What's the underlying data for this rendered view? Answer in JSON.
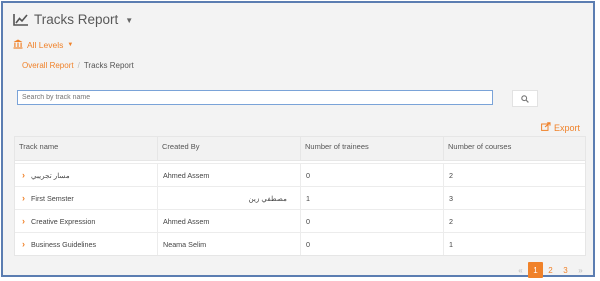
{
  "header": {
    "title": "Tracks Report",
    "levels_label": "All Levels"
  },
  "breadcrumb": {
    "parent": "Overall Report",
    "separator": "/",
    "current": "Tracks Report"
  },
  "search": {
    "placeholder": "Search by track name",
    "value": ""
  },
  "export_label": "Export",
  "table": {
    "headers": [
      "Track name",
      "Created By",
      "Number of trainees",
      "Number of courses"
    ],
    "rows": [
      {
        "track": "مسار تجريبي",
        "created_by": "Ahmed Assem",
        "trainees": "0",
        "courses": "2"
      },
      {
        "track": "First Semster",
        "created_by": "مصطفي زين",
        "trainees": "1",
        "courses": "3"
      },
      {
        "track": "Creative Expression",
        "created_by": "Ahmed Assem",
        "trainees": "0",
        "courses": "2"
      },
      {
        "track": "Business Guidelines",
        "created_by": "Neama Selim",
        "trainees": "0",
        "courses": "1"
      }
    ]
  },
  "pagination": {
    "prev": "«",
    "pages": [
      "1",
      "2",
      "3"
    ],
    "active_page": "1",
    "next": "»"
  },
  "colors": {
    "accent": "#f0822a",
    "frame_border": "#5b7db1"
  },
  "icons": {
    "title": "line-chart-icon",
    "levels": "institution-icon",
    "search": "search-icon",
    "export": "export-icon",
    "row_expand": "chevron-right-icon"
  }
}
